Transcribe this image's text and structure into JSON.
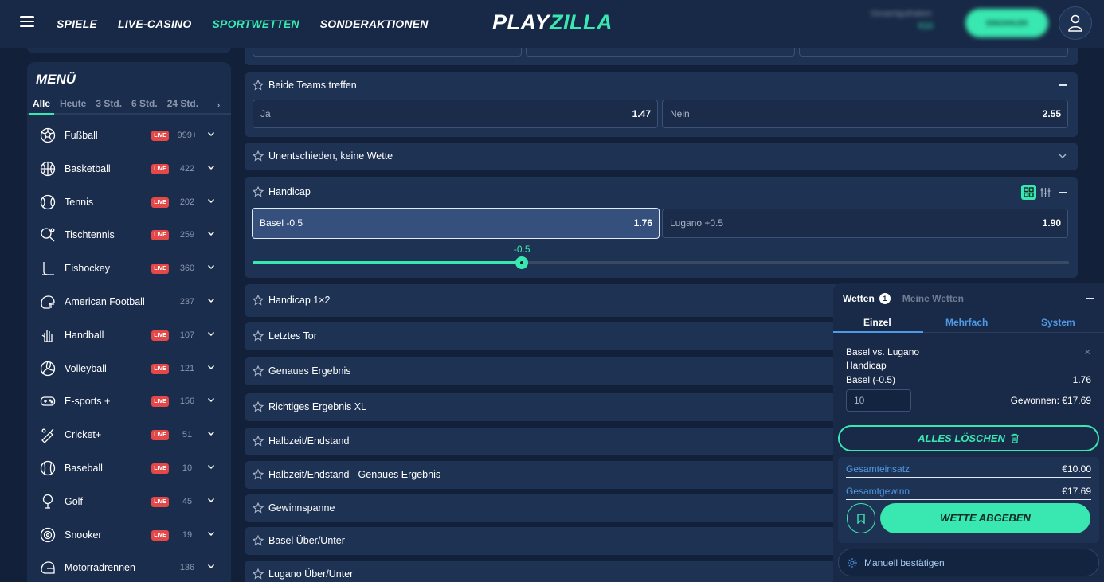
{
  "header": {
    "nav": [
      "SPIELE",
      "LIVE-CASINO",
      "SPORTWETTEN",
      "SONDERAKTIONEN"
    ],
    "logo_a": "PLAY",
    "logo_b": "ZILLA",
    "balance_label": "Gesamtguthaben",
    "balance_value": "€10",
    "deposit_label": "EINZAHLEN",
    "accent": "#39e8b0"
  },
  "sidebar": {
    "title": "MENÜ",
    "filters": [
      "Alle",
      "Heute",
      "3 Std.",
      "6 Std.",
      "24 Std."
    ],
    "live_label": "LIVE",
    "sports": [
      {
        "name": "Fußball",
        "live": true,
        "count": "999+",
        "icon": "soccer-ball-icon"
      },
      {
        "name": "Basketball",
        "live": true,
        "count": "422",
        "icon": "basketball-icon"
      },
      {
        "name": "Tennis",
        "live": true,
        "count": "202",
        "icon": "tennis-ball-icon"
      },
      {
        "name": "Tischtennis",
        "live": true,
        "count": "259",
        "icon": "table-tennis-icon"
      },
      {
        "name": "Eishockey",
        "live": true,
        "count": "360",
        "icon": "ice-hockey-icon"
      },
      {
        "name": "American Football",
        "live": false,
        "count": "237",
        "icon": "american-football-helmet-icon"
      },
      {
        "name": "Handball",
        "live": true,
        "count": "107",
        "icon": "handball-icon"
      },
      {
        "name": "Volleyball",
        "live": true,
        "count": "121",
        "icon": "volleyball-icon"
      },
      {
        "name": "E-sports +",
        "live": true,
        "count": "156",
        "icon": "gamepad-icon"
      },
      {
        "name": "Cricket+",
        "live": true,
        "count": "51",
        "icon": "cricket-bat-icon"
      },
      {
        "name": "Baseball",
        "live": true,
        "count": "10",
        "icon": "baseball-icon"
      },
      {
        "name": "Golf",
        "live": true,
        "count": "45",
        "icon": "golf-icon"
      },
      {
        "name": "Snooker",
        "live": true,
        "count": "19",
        "icon": "snooker-icon"
      },
      {
        "name": "Motorradrennen",
        "live": false,
        "count": "136",
        "icon": "motorcycle-helmet-icon"
      }
    ]
  },
  "markets": {
    "btts": {
      "title": "Beide Teams treffen",
      "odds": [
        {
          "label": "Ja",
          "value": "1.47"
        },
        {
          "label": "Nein",
          "value": "2.55"
        }
      ]
    },
    "dnb": {
      "title": "Unentschieden, keine Wette"
    },
    "handicap": {
      "title": "Handicap",
      "odds": [
        {
          "label": "Basel -0.5",
          "value": "1.76",
          "selected": true
        },
        {
          "label": "Lugano +0.5",
          "value": "1.90"
        }
      ],
      "slider_value": "-0.5",
      "slider_fraction": 0.33
    },
    "collapsed": [
      "Handicap 1×2",
      "Letztes Tor",
      "Genaues Ergebnis",
      "Richtiges Ergebnis XL",
      "Halbzeit/Endstand",
      "Halbzeit/Endstand - Genaues Ergebnis",
      "Gewinnspanne",
      "Basel Über/Unter",
      "Lugano Über/Unter"
    ]
  },
  "betslip": {
    "tab_bets": "Wetten",
    "bets_count": "1",
    "tab_my_bets": "Meine Wetten",
    "modes": [
      "Einzel",
      "Mehrfach",
      "System"
    ],
    "selection": {
      "match": "Basel vs. Lugano",
      "market": "Handicap",
      "pick": "Basel (-0.5)",
      "odd": "1.76"
    },
    "stake": "10",
    "win": "Gewonnen: €17.69",
    "clear_all": "ALLES LÖSCHEN",
    "total_stake_label": "Gesamteinsatz",
    "total_stake": "€10.00",
    "total_win_label": "Gesamtgewinn",
    "total_win": "€17.69",
    "place_bet": "WETTE ABGEBEN",
    "confirm_manual": "Manuell bestätigen"
  }
}
